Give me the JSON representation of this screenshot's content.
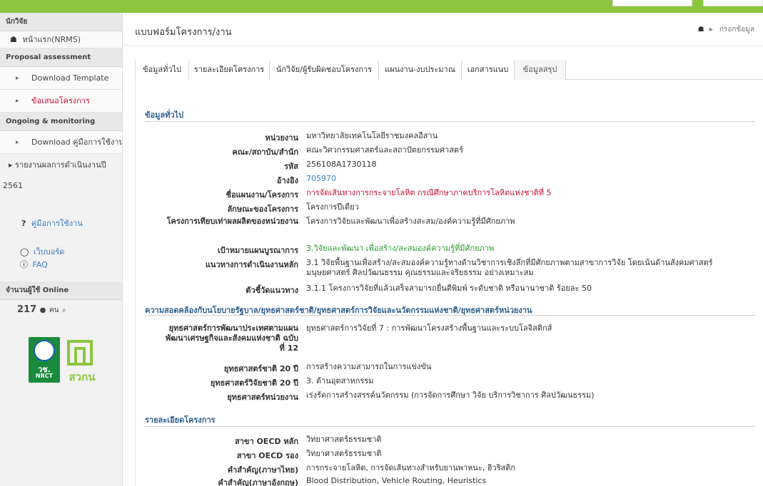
{
  "sidebar": {
    "section_researcher": "นักวิจัย",
    "home": "หน้าแรก(NRMS)",
    "section_proposal": "Proposal assessment",
    "download_template": "Download Template",
    "proposal": "ข้อเสนอโครงการ",
    "section_ongoing": "Ongoing & monitoring",
    "download_manual": "Download คู่มือการใช้งาน",
    "report": "รายงานผลการดำเนินงานปี",
    "report_year": "2561",
    "user_manual": "คู่มือการใช้งาน",
    "webboard": "เว็บบอร์ด",
    "faq": "FAQ",
    "section_online": "จำนวนผู้ใช้ Online",
    "online_count": "217",
    "online_unit": "คน",
    "logo_left_text": "วช.",
    "logo_left_sub": "NRCT",
    "logo_right_text": "สวกน"
  },
  "header": {
    "title": "แบบฟอร์มโครงการ/งาน",
    "breadcrumb": "กรอกข้อมูล"
  },
  "tabs": [
    {
      "label": "ข้อมูลทั่วไป"
    },
    {
      "label": "รายละเอียดโครงการ"
    },
    {
      "label": "นักวิจัย/ผู้รับผิดชอบโครงการ"
    },
    {
      "label": "แผนงาน-งบประมาณ"
    },
    {
      "label": "เอกสารแนบ"
    },
    {
      "label": "ข้อมูลสรุป"
    }
  ],
  "general": {
    "title": "ข้อมูลทั่วไป",
    "rows": [
      {
        "label": "หน่วยงาน",
        "value": "มหาวิทยาลัยเทคโนโลยีราชมงคลอีสาน"
      },
      {
        "label": "คณะ/สถาบัน/สำนัก",
        "value": "คณะวิศวกรรมศาสตร์และสถาปัตยกรรมศาสตร์"
      },
      {
        "label": "รหัส",
        "value": "256108A1730118"
      },
      {
        "label": "อ้างอิง",
        "value": "705970"
      },
      {
        "label": "ชื่อแผนงาน/โครงการ",
        "value": "การจัดเส้นทางการกระจายโลหิต กรณีศึกษาภาคบริการโลหิตแห่งชาติที่ 5"
      },
      {
        "label": "ลักษณะของโครงการ",
        "value": "โครงการปีเดียว"
      },
      {
        "label": "โครงการเทียบเท่าผลผลิตของหน่วยงาน",
        "value": "โครงการวิจัยและพัฒนาเพื่อสร้างสะสม/องค์ความรู้ที่มีศักยภาพ"
      },
      {
        "label": "เป้าหมายแผนบูรณาการ",
        "value": "3.วิจัยและพัฒนา เพื่อสร้าง/สะสมองค์ความรู้ที่มีศักยภาพ"
      },
      {
        "label": "แนวทางการดำเนินงานหลัก",
        "value": "3.1 วิจัยพื้นฐานเพื่อสร้าง/สะสมองค์ความรู้ทางด้านวิชาการเชิงลึกที่มีศักยภาพตามสาขาการวิจัย โดยเน้นด้านสังคมศาสตร์ มนุษยศาสตร์ ศิลปวัฒนธรรม คุณธรรมและจริยธรรม อย่างเหมาะสม"
      },
      {
        "label": "ตัวชี้วัดแนวทาง",
        "value": "3.1.1 โครงการวิจัยที่แล้วเสร็จสามารถยื่นตีพิมพ์ ระดับชาติ หรือนานาชาติ ร้อยละ 50"
      }
    ]
  },
  "policy": {
    "title": "ความสอดคล้องกับนโยบายรัฐบาล/ยุทธศาสตร์ชาติ/ยุทธศาสตร์การวิจัยและนวัตกรรมแห่งชาติ/ยุทธศาสตร์หน่วยงาน",
    "rows": [
      {
        "label": "ยุทธศาสตร์การพัฒนาประเทศตามแผนพัฒนาเศรษฐกิจและสังคมแห่งชาติ ฉบับที่ 12",
        "value": "ยุทธศาสตร์การวิจัยที่ 7 : การพัฒนาโครงสร้างพื้นฐานและระบบโลจิสติกส์"
      },
      {
        "label": "ยุทธศาสตร์ชาติ 20 ปี",
        "value": "การสร้างความสามารถในการแข่งขัน"
      },
      {
        "label": "ยุทธศาสตร์วิจัยชาติ 20 ปี",
        "value": "3. ด้านอุตสาหกรรม"
      },
      {
        "label": "ยุทธศาสตร์หน่วยงาน",
        "value": "เร่งรัดการสร้างสรรค์นวัตกรรม (การจัดการศึกษา วิจัย บริการวิชาการ ศิลปวัฒนธรรม)"
      }
    ]
  },
  "detail": {
    "title": "รายละเอียดโครงการ",
    "rows": [
      {
        "label": "สาขา OECD หลัก",
        "value": "วิทยาศาสตร์ธรรมชาติ"
      },
      {
        "label": "สาขา OECD รอง",
        "value": "วิทยาศาสตร์ธรรมชาติ"
      },
      {
        "label": "คำสำคัญ(ภาษาไทย)",
        "value": "การกระจายโลหิต, การจัดเส้นทางสำหรับยานพาหนะ, ฮิวริสติก"
      },
      {
        "label": "คำสำคัญ(ภาษาอังกฤษ)",
        "value": "Blood Distribution, Vehicle Routing, Heuristics"
      }
    ]
  },
  "colors": {
    "accent_green": "#8cc63f",
    "link_blue": "#3b7ec3",
    "alert_red": "#c0143c",
    "section_blue": "#2c5f8d"
  }
}
